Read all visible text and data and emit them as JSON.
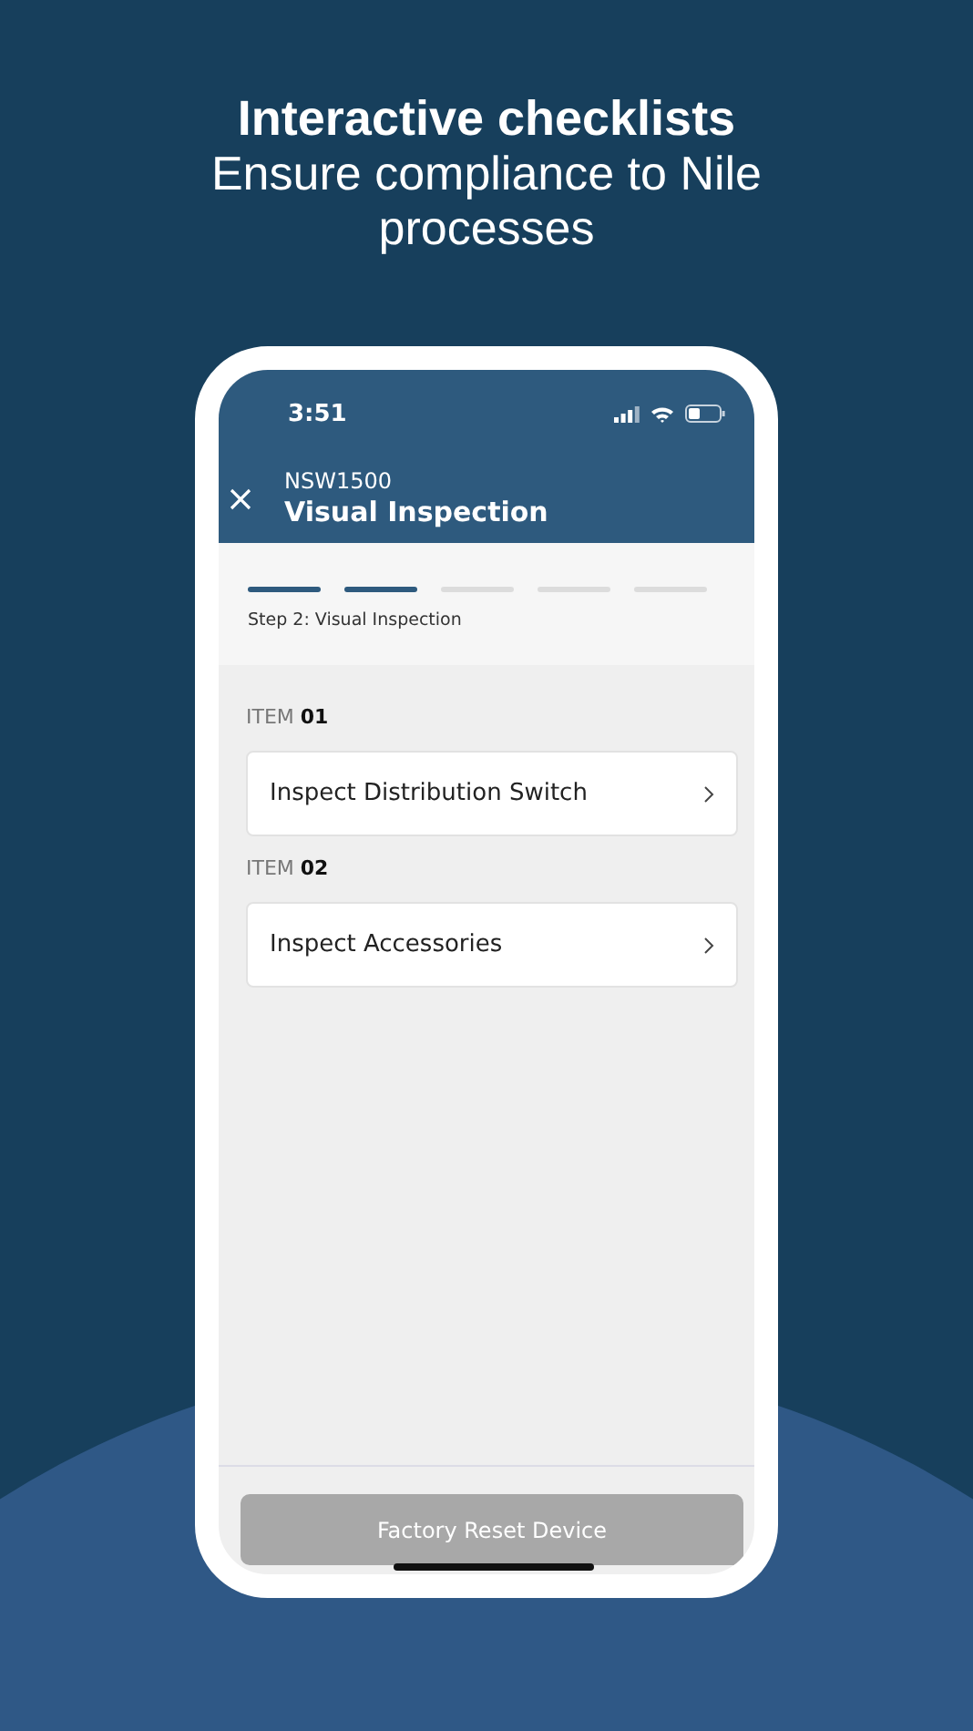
{
  "headline": {
    "title": "Interactive checklists",
    "subtitle": "Ensure compliance to Nile processes"
  },
  "status_bar": {
    "time": "3:51"
  },
  "header": {
    "code": "NSW1500",
    "title": "Visual Inspection"
  },
  "progress": {
    "steps": [
      {
        "completed": true
      },
      {
        "completed": true
      },
      {
        "completed": false
      },
      {
        "completed": false
      },
      {
        "completed": false
      }
    ],
    "label": "Step 2: Visual Inspection"
  },
  "items": [
    {
      "prefix": "ITEM",
      "number": "01",
      "title": "Inspect Distribution Switch"
    },
    {
      "prefix": "ITEM",
      "number": "02",
      "title": "Inspect Accessories"
    }
  ],
  "footer_button": {
    "label": "Factory Reset Device",
    "disabled": true
  }
}
